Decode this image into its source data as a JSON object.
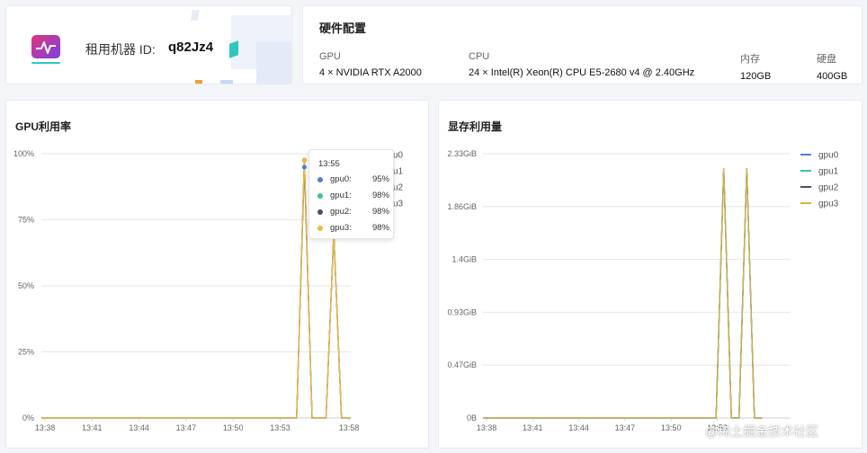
{
  "machine": {
    "label": "租用机器 ID:",
    "id": "q82Jz4"
  },
  "hardware": {
    "title": "硬件配置",
    "columns": [
      {
        "head": "GPU",
        "value": "4 × NVIDIA RTX A2000"
      },
      {
        "head": "CPU",
        "value": "24 × Intel(R) Xeon(R) CPU E5-2680 v4 @ 2.40GHz"
      },
      {
        "head": "内存",
        "value": "120GB"
      },
      {
        "head": "硬盘",
        "value": "400GB"
      }
    ]
  },
  "gpu_chart_title": "GPU利用率",
  "mem_chart_title": "显存利用量",
  "tooltip": {
    "time": "13:55",
    "rows": [
      {
        "name": "gpu0:",
        "value": "95%",
        "color": "#4f7fd8"
      },
      {
        "name": "gpu1:",
        "value": "98%",
        "color": "#3fc48f"
      },
      {
        "name": "gpu2:",
        "value": "98%",
        "color": "#4a4e69"
      },
      {
        "name": "gpu3:",
        "value": "98%",
        "color": "#f6b73c"
      }
    ]
  },
  "watermark": "@稀土掘金技术社区",
  "chart_data": [
    {
      "type": "line",
      "title": "GPU利用率",
      "x_ticks": [
        "13:38",
        "13:41",
        "13:44",
        "13:47",
        "13:50",
        "13:53",
        "13:58"
      ],
      "y_ticks": [
        "100%",
        "75%",
        "50%",
        "25%",
        "0%"
      ],
      "ylim": [
        0,
        100
      ],
      "legend": [
        "gpu0",
        "gpu1",
        "gpu2",
        "gpu3"
      ],
      "legend_visible": [
        "u0",
        "u1",
        "u2",
        "u3"
      ],
      "grid": true,
      "series": [
        {
          "name": "gpu0",
          "color": "#4f7fd8",
          "points": [
            [
              0,
              0
            ],
            [
              16.5,
              0
            ],
            [
              17,
              95
            ],
            [
              17.5,
              0
            ],
            [
              18.4,
              0
            ],
            [
              18.9,
              70
            ],
            [
              19.4,
              0
            ],
            [
              20,
              0
            ]
          ]
        },
        {
          "name": "gpu1",
          "color": "#3fc48f",
          "points": [
            [
              0,
              0
            ],
            [
              16.5,
              0
            ],
            [
              17,
              98
            ],
            [
              17.5,
              0
            ],
            [
              18.4,
              0
            ],
            [
              18.9,
              70
            ],
            [
              19.4,
              0
            ],
            [
              20,
              0
            ]
          ]
        },
        {
          "name": "gpu2",
          "color": "#4a4e69",
          "points": [
            [
              0,
              0
            ],
            [
              16.5,
              0
            ],
            [
              17,
              98
            ],
            [
              17.5,
              0
            ],
            [
              18.4,
              0
            ],
            [
              18.9,
              70
            ],
            [
              19.4,
              0
            ],
            [
              20,
              0
            ]
          ]
        },
        {
          "name": "gpu3",
          "color": "#f6b73c",
          "points": [
            [
              0,
              0
            ],
            [
              16.5,
              0
            ],
            [
              17,
              98
            ],
            [
              17.5,
              0
            ],
            [
              18.4,
              0
            ],
            [
              18.9,
              70
            ],
            [
              19.4,
              0
            ],
            [
              20,
              0
            ]
          ]
        }
      ]
    },
    {
      "type": "line",
      "title": "显存利用量",
      "x_ticks": [
        "13:38",
        "13:41",
        "13:44",
        "13:47",
        "13:50",
        "13:53"
      ],
      "y_ticks": [
        "2.33GiB",
        "1.86GiB",
        "1.4GiB",
        "0.93GiB",
        "0.47GiB",
        "0B"
      ],
      "ylim": [
        0,
        2.33
      ],
      "legend": [
        "gpu0",
        "gpu1",
        "gpu2",
        "gpu3"
      ],
      "grid": true,
      "series": [
        {
          "name": "gpu0",
          "color": "#4f7fd8",
          "points": [
            [
              0,
              0
            ],
            [
              15.2,
              0
            ],
            [
              15.7,
              2.2
            ],
            [
              16.2,
              0
            ],
            [
              16.7,
              0
            ],
            [
              17.2,
              2.2
            ],
            [
              17.7,
              0
            ],
            [
              18.2,
              0
            ]
          ]
        },
        {
          "name": "gpu1",
          "color": "#3fc48f",
          "points": [
            [
              0,
              0
            ],
            [
              15.2,
              0
            ],
            [
              15.7,
              2.2
            ],
            [
              16.2,
              0
            ],
            [
              16.7,
              0
            ],
            [
              17.2,
              2.2
            ],
            [
              17.7,
              0
            ],
            [
              18.2,
              0
            ]
          ]
        },
        {
          "name": "gpu2",
          "color": "#4a4e69",
          "points": [
            [
              0,
              0
            ],
            [
              15.2,
              0
            ],
            [
              15.7,
              2.2
            ],
            [
              16.2,
              0
            ],
            [
              16.7,
              0
            ],
            [
              17.2,
              2.2
            ],
            [
              17.7,
              0
            ],
            [
              18.2,
              0
            ]
          ]
        },
        {
          "name": "gpu3",
          "color": "#d4b24a",
          "points": [
            [
              0,
              0
            ],
            [
              15.2,
              0
            ],
            [
              15.7,
              2.2
            ],
            [
              16.2,
              0
            ],
            [
              16.7,
              0
            ],
            [
              17.2,
              2.2
            ],
            [
              17.7,
              0
            ],
            [
              18.2,
              0
            ]
          ]
        }
      ]
    }
  ]
}
